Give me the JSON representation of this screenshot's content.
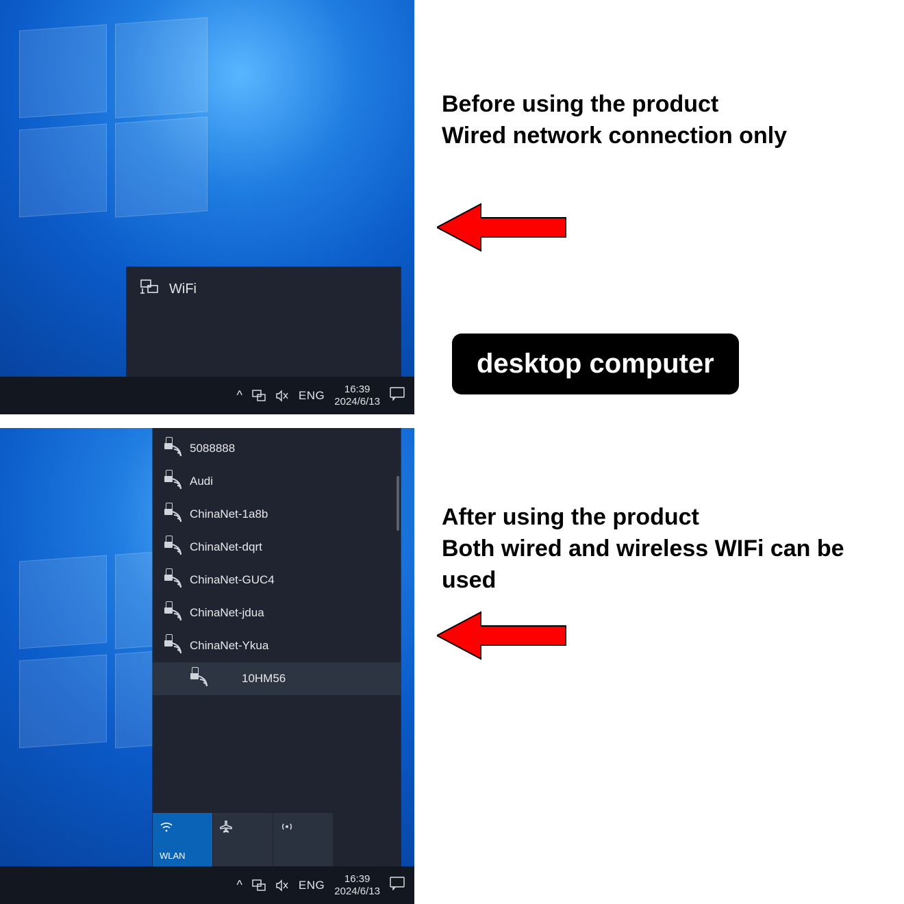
{
  "captions": {
    "before": "Before using the product\nWired network connection only",
    "after": "After using the product\nBoth wired and wireless WIFi can be used",
    "pill": "desktop computer"
  },
  "panel_top": {
    "header": "WiFi"
  },
  "wifi": {
    "items": [
      {
        "ssid": "5088888"
      },
      {
        "ssid": "Audi"
      },
      {
        "ssid": "ChinaNet-1a8b"
      },
      {
        "ssid": "ChinaNet-dqrt"
      },
      {
        "ssid": "ChinaNet-GUC4"
      },
      {
        "ssid": "ChinaNet-jdua"
      },
      {
        "ssid": "ChinaNet-Ykua"
      },
      {
        "ssid": "10HM56",
        "selected": true
      }
    ],
    "tiles": {
      "wlan": "WLAN",
      "airplane": "",
      "hotspot": ""
    }
  },
  "taskbar": {
    "lang": "ENG",
    "time": "16:39",
    "date": "2024/6/13"
  }
}
